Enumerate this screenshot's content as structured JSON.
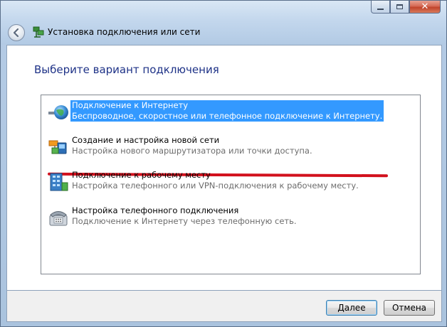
{
  "window": {
    "title": "Установка подключения или сети",
    "caption_buttons": {
      "minimize_icon": "minimize-icon",
      "maximize_icon": "maximize-icon",
      "close_icon": "close-icon",
      "close_glyph": "✕"
    }
  },
  "heading": "Выберите вариант подключения",
  "options": [
    {
      "title": "Подключение к Интернету",
      "description": "Беспроводное, скоростное или телефонное подключение к Интернету.",
      "icon": "globe-network-icon",
      "selected": true
    },
    {
      "title": "Создание и настройка новой сети",
      "description": "Настройка нового маршрутизатора или точки доступа.",
      "icon": "new-network-icon",
      "selected": false
    },
    {
      "title": "Подключение к рабочему месту",
      "description": "Настройка телефонного или VPN-подключения к рабочему месту.",
      "icon": "workplace-icon",
      "selected": false
    },
    {
      "title": "Настройка телефонного подключения",
      "description": "Подключение к Интернету через телефонную сеть.",
      "icon": "telephone-icon",
      "selected": false
    }
  ],
  "buttons": {
    "next": "Далее",
    "cancel": "Отмена"
  },
  "colors": {
    "selection": "#3399ff",
    "heading": "#1e3287",
    "annotation_underline": "#d2111d"
  }
}
